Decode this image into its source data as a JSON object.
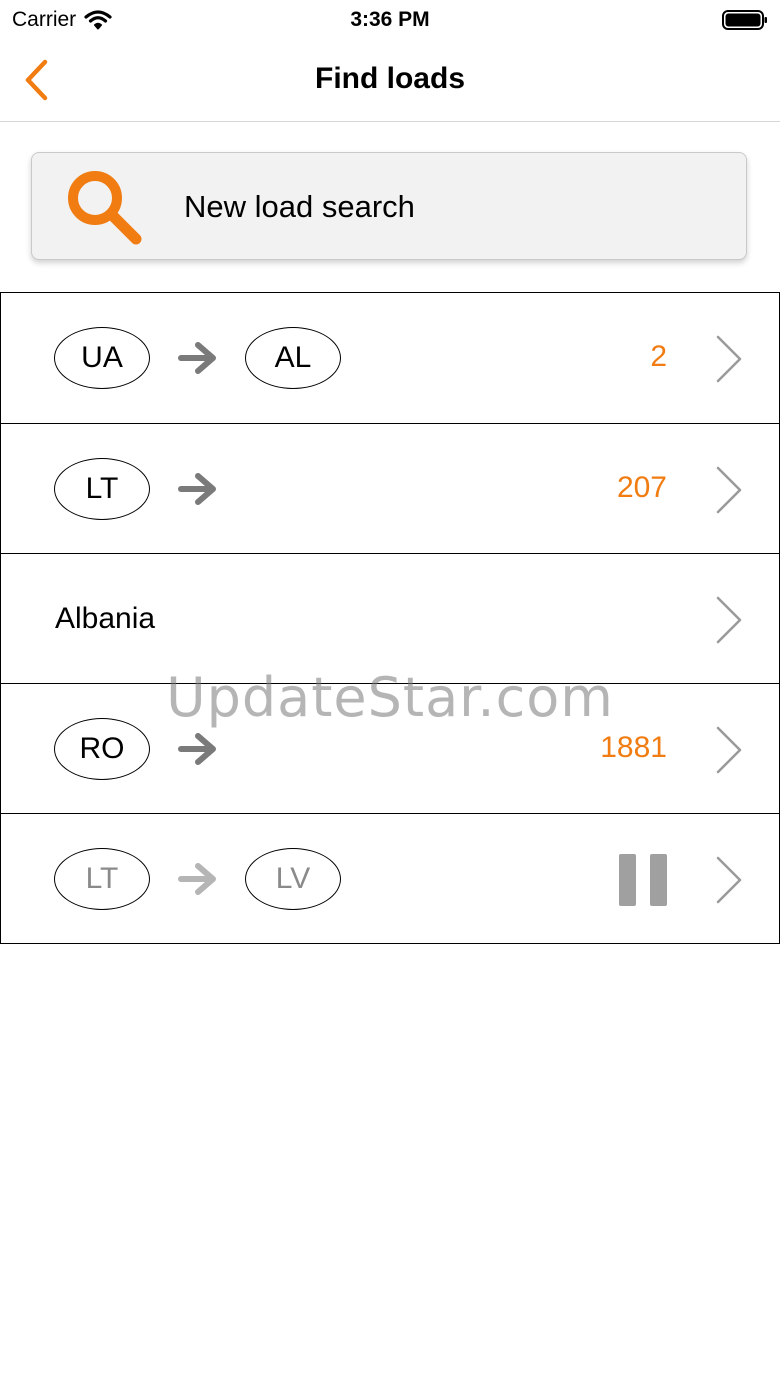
{
  "status_bar": {
    "carrier": "Carrier",
    "time": "3:36 PM",
    "icons": [
      "wifi-icon",
      "battery-icon"
    ]
  },
  "nav": {
    "title": "Find loads",
    "back_icon": "chevron-left-icon"
  },
  "search": {
    "label": "New load search",
    "icon": "search-icon"
  },
  "routes": [
    {
      "from": "UA",
      "to": "AL",
      "count": "2",
      "paused": false
    },
    {
      "from": "LT",
      "to": "",
      "count": "207",
      "paused": false
    },
    {
      "text": "Albania"
    },
    {
      "from": "RO",
      "to": "",
      "count": "1881",
      "paused": false
    },
    {
      "from": "LT",
      "to": "LV",
      "count": "",
      "paused": true
    }
  ],
  "watermark": "UpdateStar.com",
  "colors": {
    "accent": "#f07c12",
    "arrow": "#7a7a7a",
    "arrow_paused": "#b5b5b5",
    "pause": "#a0a0a0",
    "chevron": "#9a9a9a"
  }
}
